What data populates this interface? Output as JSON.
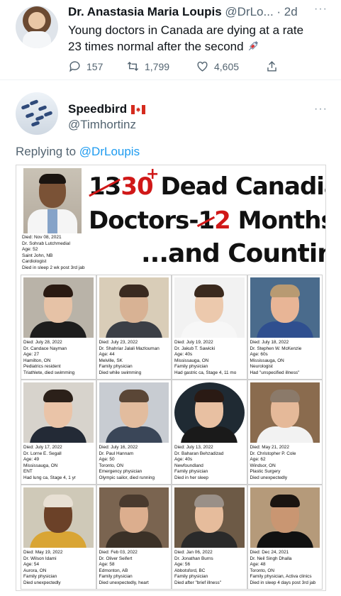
{
  "tweet": {
    "author_name": "Dr. Anastasia Maria Loupis",
    "author_handle": "@DrLo...",
    "time": "· 2d",
    "text": "Young doctors in Canada are dying at a rate 23 times normal after the second",
    "replies": "157",
    "retweets": "1,799",
    "likes": "4,605",
    "more_label": "···"
  },
  "reply": {
    "author_name": "Speedbird",
    "author_handle": "@Timhortinz",
    "replying_prefix": "Replying to",
    "replying_handle": "@DrLoupis",
    "more_label": "···"
  },
  "meme": {
    "headline": {
      "struck_number": "13",
      "new_number": "30",
      "plus": "+",
      "line1_rest": "Dead Canadian",
      "line2_start": "Doctors-",
      "struck_months": "1",
      "new_months": "2",
      "line2_rest": "Months",
      "line3": "...and Counting!"
    },
    "hero_caption": [
      "Died: Nov 08, 2021",
      "Dr. Sohrab Lutchmedial",
      "Age: 52",
      "Saint John, NB",
      "Cardiologist",
      "Died in sleep 2 wk post 3rd jab"
    ],
    "doctors": [
      {
        "lines": [
          "Died: July 28, 2022",
          "Dr. Candace Nayman",
          "Age: 27",
          "Hamilton, ON",
          "Pediatrics resident",
          "Triathlete, died swimming"
        ],
        "skin": "#e6c2a6",
        "hair": "#2a1a12",
        "bg": "#b9b3a8",
        "body": "#1d1d1d"
      },
      {
        "lines": [
          "Died: July 23, 2022",
          "Dr. Shahriar Jalali Mazlouman",
          "Age: 44",
          "Melville, SK",
          "Family physician",
          "Died while swimming"
        ],
        "skin": "#d8b294",
        "hair": "#3a2a20",
        "bg": "#d9cdb8",
        "body": "#3b3f46"
      },
      {
        "lines": [
          "Died: July 19, 2022",
          "Dr. Jakub T. Sawicki",
          "Age: 40s",
          "Mississauga, ON",
          "Family physician",
          "Had gastric ca, Stage 4, 11 mo"
        ],
        "skin": "#ecc9ad",
        "hair": "#3b2a1e",
        "bg": "#f2f2f2",
        "body": "#f7f7f7"
      },
      {
        "lines": [
          "Died: July 18, 2022",
          "Dr. Stephen W. McKenzie",
          "Age: 60s",
          "Mississauga, ON",
          "Neurologist",
          "Had \"unspecified illness\""
        ],
        "skin": "#e8b596",
        "hair": "#b89a72",
        "bg": "#4a6b8c",
        "body": "#2f4f8f"
      },
      {
        "lines": [
          "Died: July 17, 2022",
          "Dr. Lorne E. Segall",
          "Age: 49",
          "Mississauga, ON",
          "ENT",
          "Had lung ca, Stage 4, 1 yr"
        ],
        "skin": "#eac4a8",
        "hair": "#2b2019",
        "bg": "#d7d3cc",
        "body": "#232a36"
      },
      {
        "lines": [
          "Died: July 16, 2022",
          "Dr. Paul Hannam",
          "Age: 50",
          "Toronto, ON",
          "Emergency physician",
          "Olympic sailor, died running"
        ],
        "skin": "#e2bc9e",
        "hair": "#5a4636",
        "bg": "#c8ccd2",
        "body": "#3a4658"
      },
      {
        "lines": [
          "Died: July 13, 2022",
          "Dr. Baharan Behzadizad",
          "Age: 40s",
          "Newfoundland",
          "Family physician",
          "Died in her sleep"
        ],
        "skin": "#e8c0a2",
        "hair": "#2a1a14",
        "bg": "#1f2a33",
        "body": "#1a1a1a"
      },
      {
        "lines": [
          "Died: May 21, 2022",
          "Dr. Christopher P. Cole",
          "Age: 62",
          "Windsor, ON",
          "Plastic Surgery",
          "Died unexpectedly"
        ],
        "skin": "#e5b999",
        "hair": "#8b7a6a",
        "bg": "#8a6b4e",
        "body": "#f2f2f2"
      },
      {
        "lines": [
          "Died: May 19, 2022",
          "Dr. Wilson Idami",
          "Age: 54",
          "Aurora, ON",
          "Family physician",
          "Died unexpectedly"
        ],
        "skin": "#6b4128",
        "hair": "#e8e0d4",
        "bg": "#cfc9b8",
        "body": "#d9a534"
      },
      {
        "lines": [
          "Died: Feb 03, 2022",
          "Dr. Oliver Seifert",
          "Age: 58",
          "Edmonton, AB",
          "Family physician",
          "Died unexpectedly, heart"
        ],
        "skin": "#dcae8e",
        "hair": "#4a3a2e",
        "bg": "#7a6450",
        "body": "#3b3127"
      },
      {
        "lines": [
          "Died: Jan 06, 2022",
          "Dr. Jonathan Burns",
          "Age: 56",
          "Abbotsford, BC",
          "Family physician",
          "Died after \"brief illness\""
        ],
        "skin": "#e6bc9c",
        "hair": "#9a9088",
        "bg": "#6d5a46",
        "body": "#2a2a2a"
      },
      {
        "lines": [
          "Died: Dec 24, 2021",
          "Dr. Neil Singh Dhalla",
          "Age: 48",
          "Toronto, ON",
          "Family physician, Activa clinics",
          "Died in sleep 4 days post 3rd jab"
        ],
        "skin": "#c99672",
        "hair": "#1a1410",
        "bg": "#b59a7a",
        "body": "#111111"
      }
    ]
  },
  "colors": {
    "accent_blue": "#1d9bf0",
    "muted_text": "#536471",
    "headline_red": "#d01818"
  },
  "icons": [
    "reply-icon",
    "retweet-icon",
    "like-icon",
    "share-icon",
    "syringe-icon",
    "canada-flag-icon"
  ]
}
